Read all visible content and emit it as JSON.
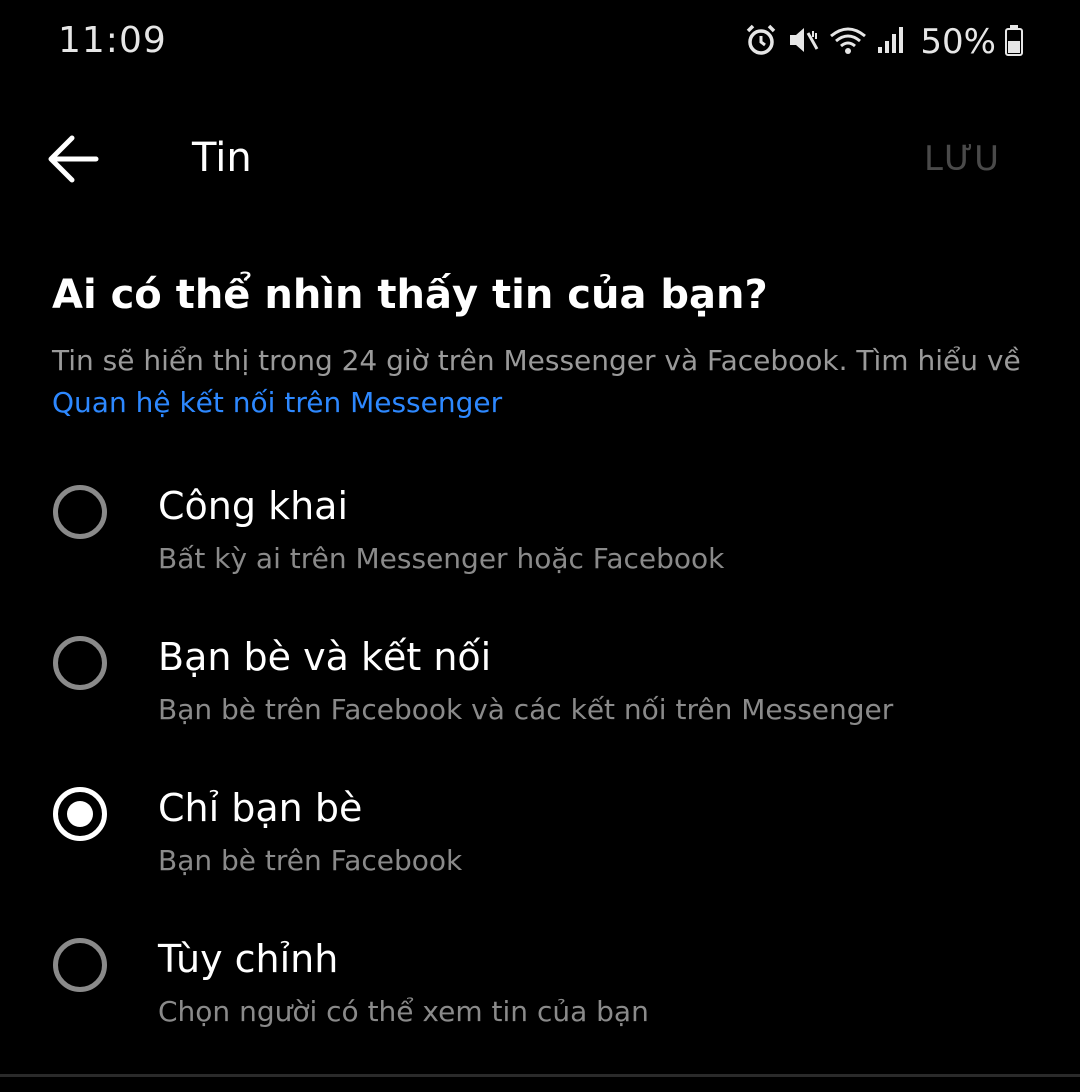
{
  "status_bar": {
    "time": "11:09",
    "battery_percent": "50%",
    "icons": [
      "alarm-icon",
      "mute-icon",
      "wifi-icon",
      "signal-icon",
      "battery-icon"
    ]
  },
  "app_bar": {
    "back_icon": "back-arrow-icon",
    "title": "Tin",
    "save_label": "LƯU"
  },
  "content": {
    "heading": "Ai có thể nhìn thấy tin của bạn?",
    "description": "Tin sẽ hiển thị trong 24 giờ trên Messenger và Facebook. Tìm hiểu về",
    "link_text": "Quan hệ kết nối trên Messenger"
  },
  "options": [
    {
      "title": "Công khai",
      "description": "Bất kỳ ai trên Messenger hoặc Facebook",
      "selected": false
    },
    {
      "title": "Bạn bè và kết nối",
      "description": "Bạn bè trên Facebook và các kết nối trên Messenger",
      "selected": false
    },
    {
      "title": "Chỉ bạn bè",
      "description": "Bạn bè trên Facebook",
      "selected": true
    },
    {
      "title": "Tùy chỉnh",
      "description": "Chọn người có thể xem tin của bạn",
      "selected": false
    }
  ],
  "colors": {
    "background": "#000000",
    "link": "#2d88ff",
    "secondary_text": "#8a8a8a",
    "disabled_action": "#4a4a4a"
  }
}
